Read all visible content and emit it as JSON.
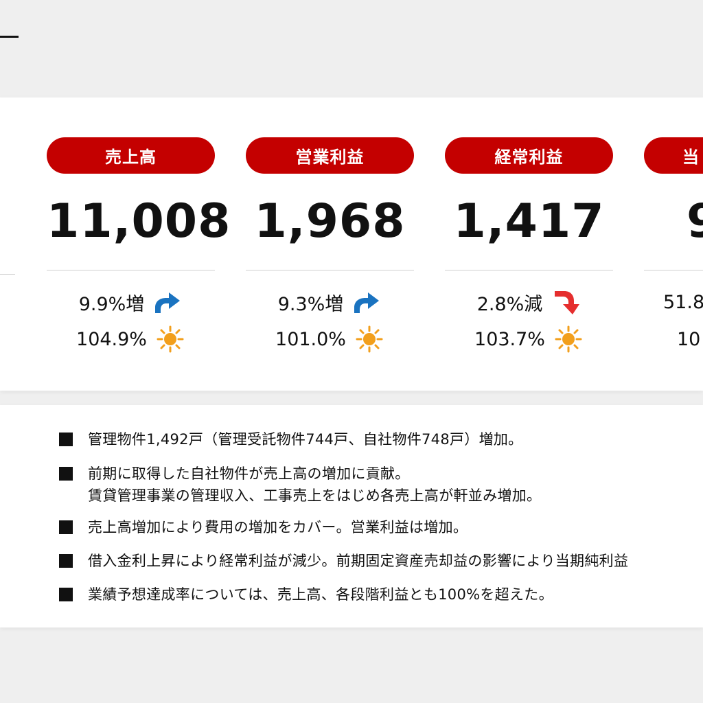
{
  "kpis": [
    {
      "label": "売上高",
      "value": "11,008",
      "change": "9.9%増",
      "change_icon": "arrow-up-icon",
      "achievement": "104.9%",
      "achievement_icon": "sun-icon"
    },
    {
      "label": "営業利益",
      "value": "1,968",
      "change": "9.3%増",
      "change_icon": "arrow-up-icon",
      "achievement": "101.0%",
      "achievement_icon": "sun-icon"
    },
    {
      "label": "経常利益",
      "value": "1,417",
      "change": "2.8%減",
      "change_icon": "arrow-down-icon",
      "achievement": "103.7%",
      "achievement_icon": "sun-icon"
    },
    {
      "label": "当",
      "value": "9",
      "change": "51.8",
      "achievement": "10"
    }
  ],
  "notes": [
    [
      "管理物件1,492戸（管理受託物件744戸、自社物件748戸）増加。"
    ],
    [
      "前期に取得した自社物件が売上高の増加に貢献。",
      "賃貸管理事業の管理収入、工事売上をはじめ各売上高が軒並み増加。"
    ],
    [
      "売上高増加により費用の増加をカバー。営業利益は増加。"
    ],
    [
      "借入金利上昇により経常利益が減少。前期固定資産売却益の影響により当期純利益"
    ],
    [
      "業績予想達成率については、売上高、各段階利益とも100%を超えた。"
    ]
  ],
  "colors": {
    "accent_red": "#c40000",
    "arrow_up_blue": "#1a73c0",
    "arrow_down_red": "#e52e2e",
    "sun_orange": "#f29f1c"
  }
}
